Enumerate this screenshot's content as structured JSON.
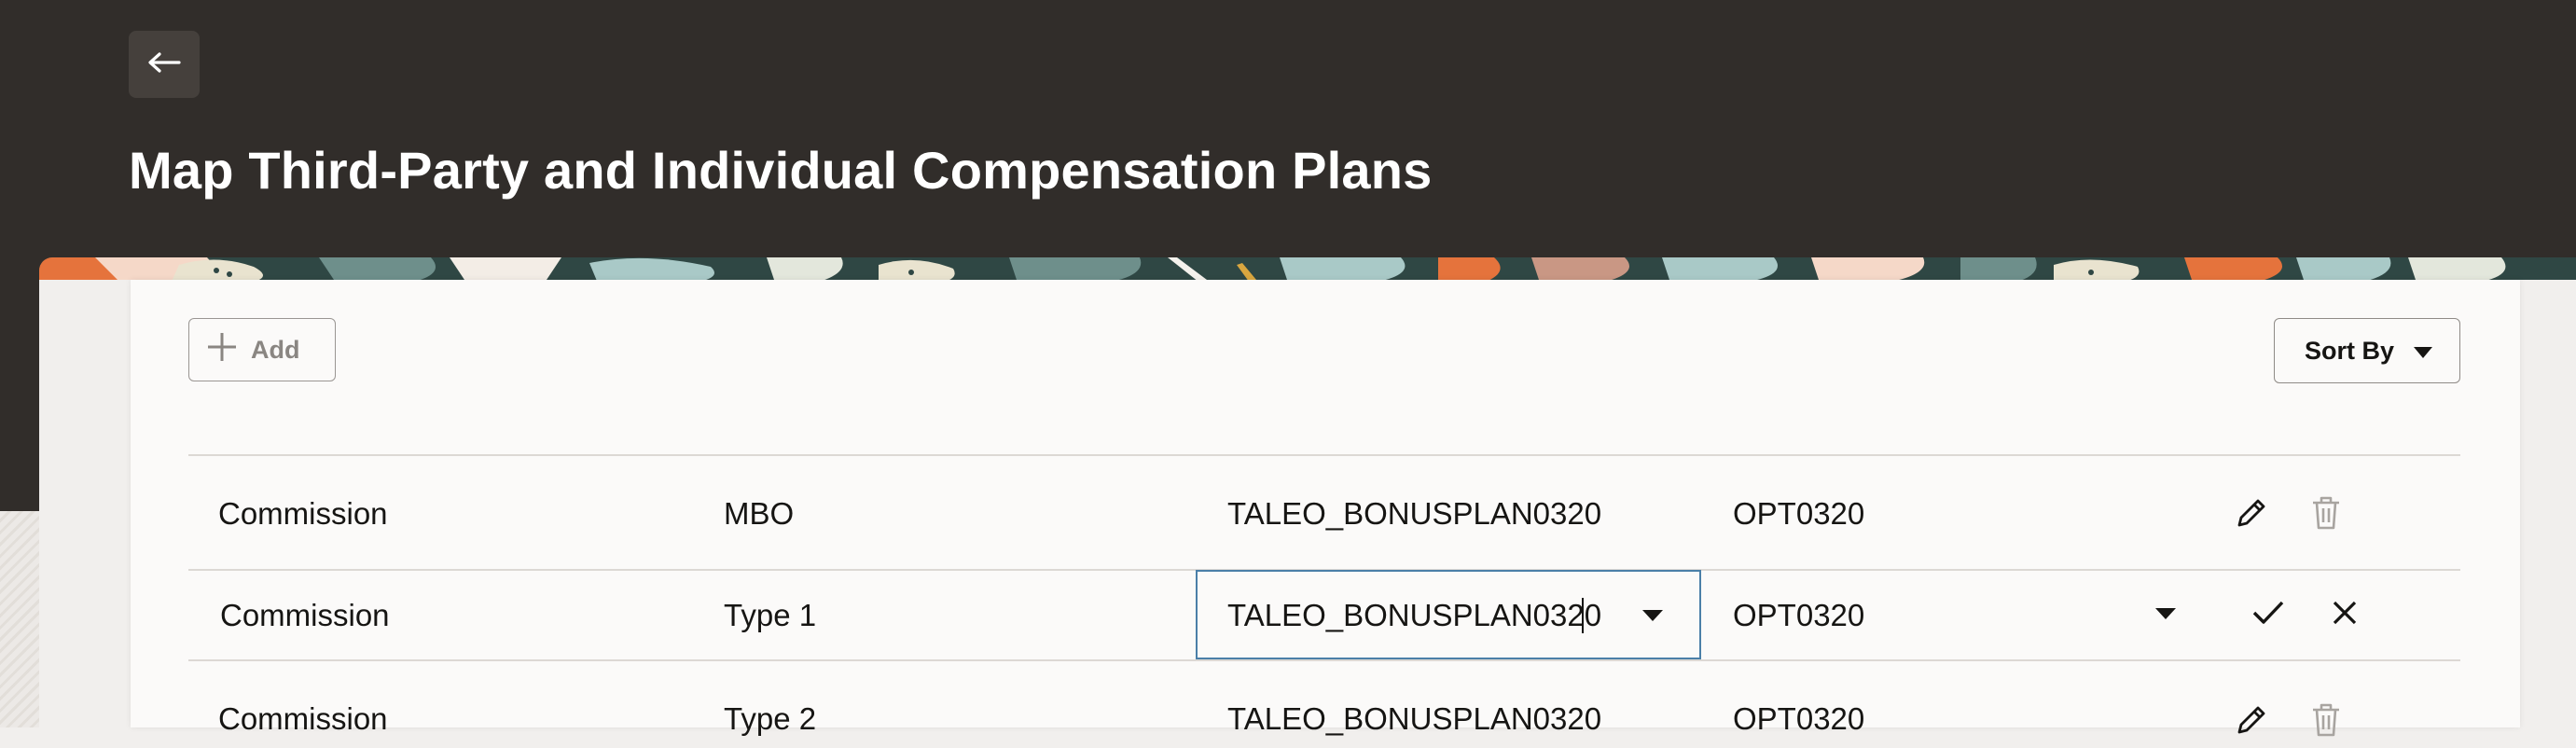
{
  "header": {
    "title": "Map Third-Party and Individual Compensation Plans"
  },
  "toolbar": {
    "add_label": "Add",
    "sort_label": "Sort By"
  },
  "rows": [
    {
      "col1": "Commission",
      "col2": "MBO",
      "col3": "TALEO_BONUSPLAN0320",
      "col4": "OPT0320",
      "mode": "view"
    },
    {
      "col1": "Commission",
      "col2": "Type 1",
      "col3": "TALEO_BONUSPLAN0320",
      "col4": "OPT0320",
      "mode": "edit"
    },
    {
      "col1": "Commission",
      "col2": "Type 2",
      "col3": "TALEO_BONUSPLAN0320",
      "col4": "OPT0320",
      "mode": "view"
    }
  ],
  "icons": {
    "back": "arrow-left-icon",
    "add": "plus-icon",
    "sort": "caret-down-icon",
    "edit": "pencil-icon",
    "delete": "trash-icon",
    "confirm": "check-icon",
    "cancel": "close-icon",
    "dropdown": "caret-down-icon"
  },
  "colors": {
    "header_bg": "#312d2a",
    "focus_border": "#4a7fa8",
    "card_bg": "#fbfaf9"
  }
}
